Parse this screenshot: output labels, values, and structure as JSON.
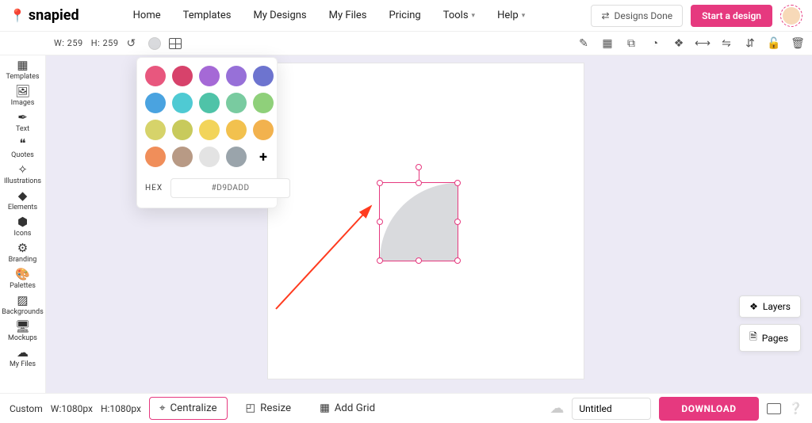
{
  "brand": "snapied",
  "nav": {
    "home": "Home",
    "templates": "Templates",
    "my_designs": "My Designs",
    "my_files": "My Files",
    "pricing": "Pricing",
    "tools": "Tools",
    "help": "Help",
    "designs_done": "Designs Done",
    "start_design": "Start a design"
  },
  "dims": {
    "w_label": "W:",
    "w": "259",
    "h_label": "H:",
    "h": "259"
  },
  "sidebar": {
    "items": [
      {
        "label": "Templates"
      },
      {
        "label": "Images"
      },
      {
        "label": "Text"
      },
      {
        "label": "Quotes"
      },
      {
        "label": "Illustrations"
      },
      {
        "label": "Elements"
      },
      {
        "label": "Icons"
      },
      {
        "label": "Branding"
      },
      {
        "label": "Palettes"
      },
      {
        "label": "Backgrounds"
      },
      {
        "label": "Mockups"
      },
      {
        "label": "My Files"
      }
    ]
  },
  "color_panel": {
    "hex_label": "HEX",
    "hex_value": "#D9DADD",
    "colors": [
      "#e8577e",
      "#d7426b",
      "#a569d6",
      "#9770d8",
      "#6d74cf",
      "#4aa3e0",
      "#4fcad3",
      "#4fc3a8",
      "#79cba0",
      "#8fd07a",
      "#d6d36a",
      "#c8ca5c",
      "#f2d45a",
      "#f2c14e",
      "#f2b24e",
      "#f08e5a",
      "#b89a85",
      "#e3e3e3",
      "#9aa4ab"
    ]
  },
  "right_panels": {
    "layers": "Layers",
    "pages": "Pages"
  },
  "bottom": {
    "custom": "Custom",
    "wlabel": "W:1080px",
    "hlabel": "H:1080px",
    "centralize": "Centralize",
    "resize": "Resize",
    "add_grid": "Add Grid",
    "title": "Untitled",
    "download": "DOWNLOAD"
  }
}
